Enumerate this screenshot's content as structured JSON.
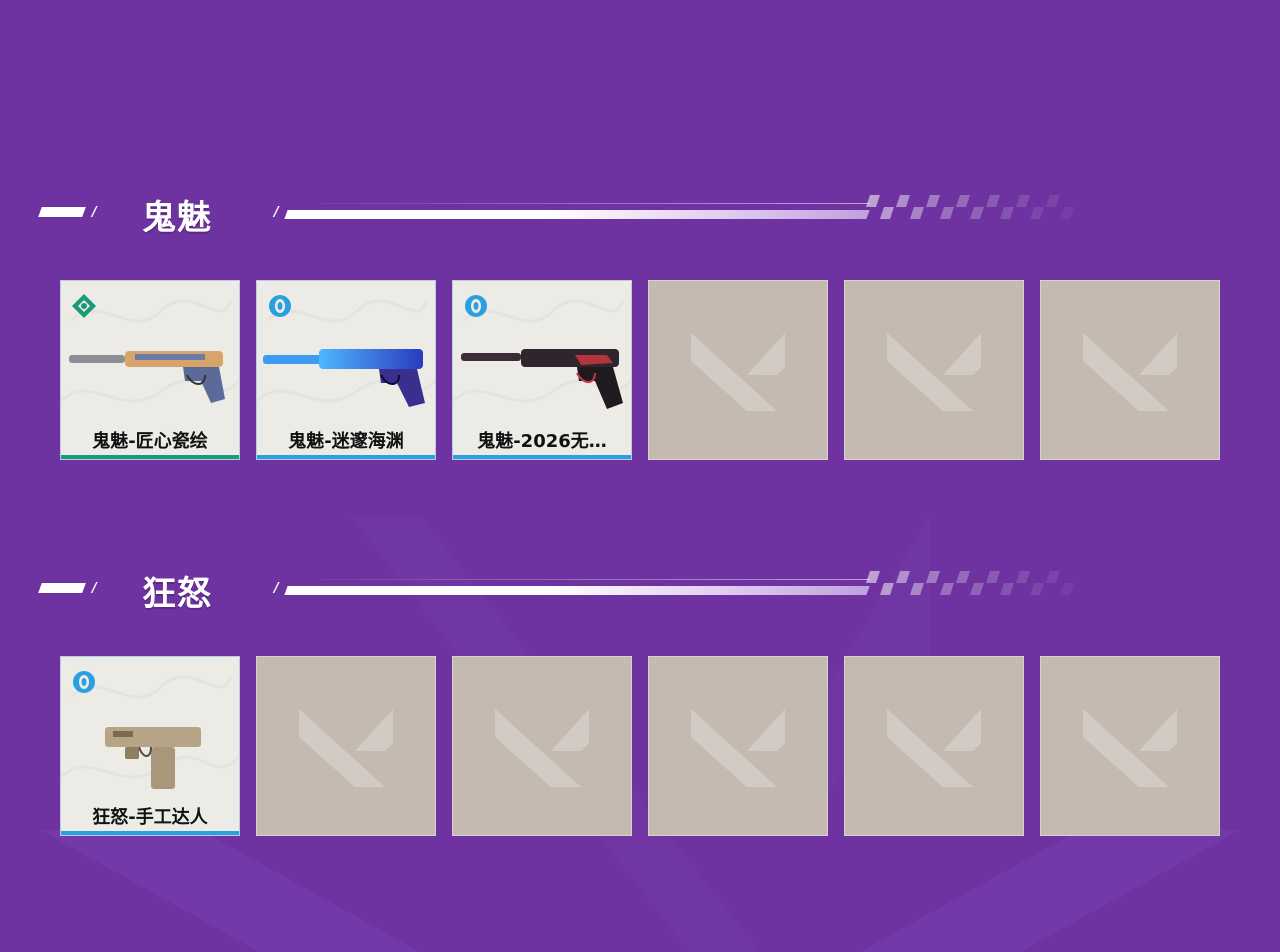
{
  "colors": {
    "page_bg": "#6e33a1",
    "rarity_green": "#1a9b78",
    "rarity_blue": "#2aa0e0",
    "empty_slot": "#c4bab2"
  },
  "sections": [
    {
      "title": "鬼魅",
      "slots": [
        {
          "name": "鬼魅-匠心瓷绘",
          "rarity": "green",
          "icon": "gem-badge-icon",
          "weapon": "ghost-pistol-ornate"
        },
        {
          "name": "鬼魅-迷邃海渊",
          "rarity": "blue",
          "icon": "ring-badge-icon",
          "weapon": "ghost-pistol-abyss"
        },
        {
          "name": "鬼魅-2026无…",
          "rarity": "blue",
          "icon": "ring-badge-icon",
          "weapon": "ghost-pistol-dark"
        },
        {
          "empty": true
        },
        {
          "empty": true
        },
        {
          "empty": true
        }
      ]
    },
    {
      "title": "狂怒",
      "slots": [
        {
          "name": "狂怒-手工达人",
          "rarity": "blue",
          "icon": "ring-badge-icon",
          "weapon": "frenzy-pistol-craft"
        },
        {
          "empty": true
        },
        {
          "empty": true
        },
        {
          "empty": true
        },
        {
          "empty": true
        },
        {
          "empty": true
        }
      ]
    }
  ]
}
